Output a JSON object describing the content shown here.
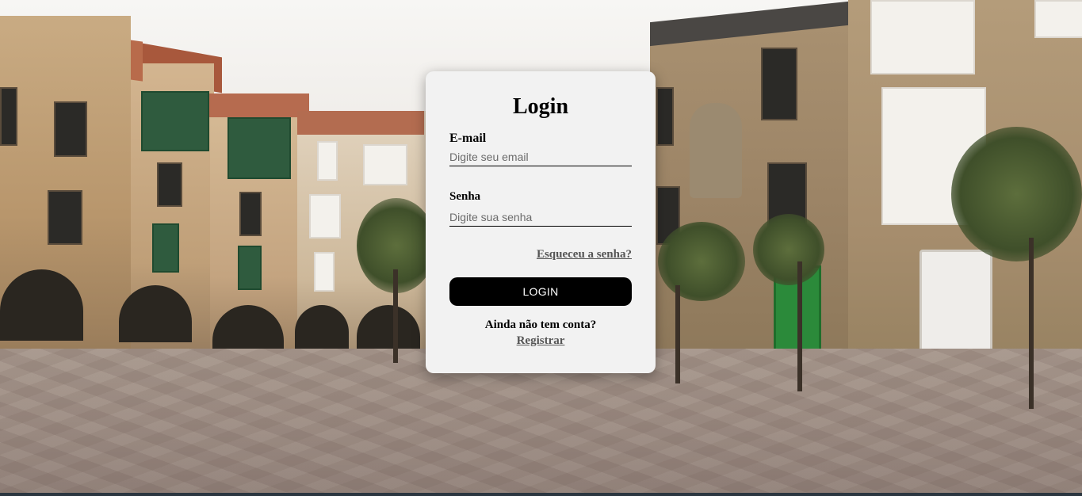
{
  "login": {
    "title": "Login",
    "email_label": "E-mail",
    "email_placeholder": "Digite seu email",
    "email_value": "",
    "password_label": "Senha",
    "password_placeholder": "Digite sua senha",
    "password_value": "",
    "forgot_link": "Esqueceu a senha?",
    "submit_label": "LOGIN",
    "no_account_text": "Ainda não tem conta?",
    "register_link": "Registrar"
  },
  "colors": {
    "card_background": "#f2f2f2",
    "button_background": "#000000",
    "button_text": "#ffffff",
    "link_color": "#555555"
  },
  "background": {
    "icon": "town-square-photo"
  }
}
